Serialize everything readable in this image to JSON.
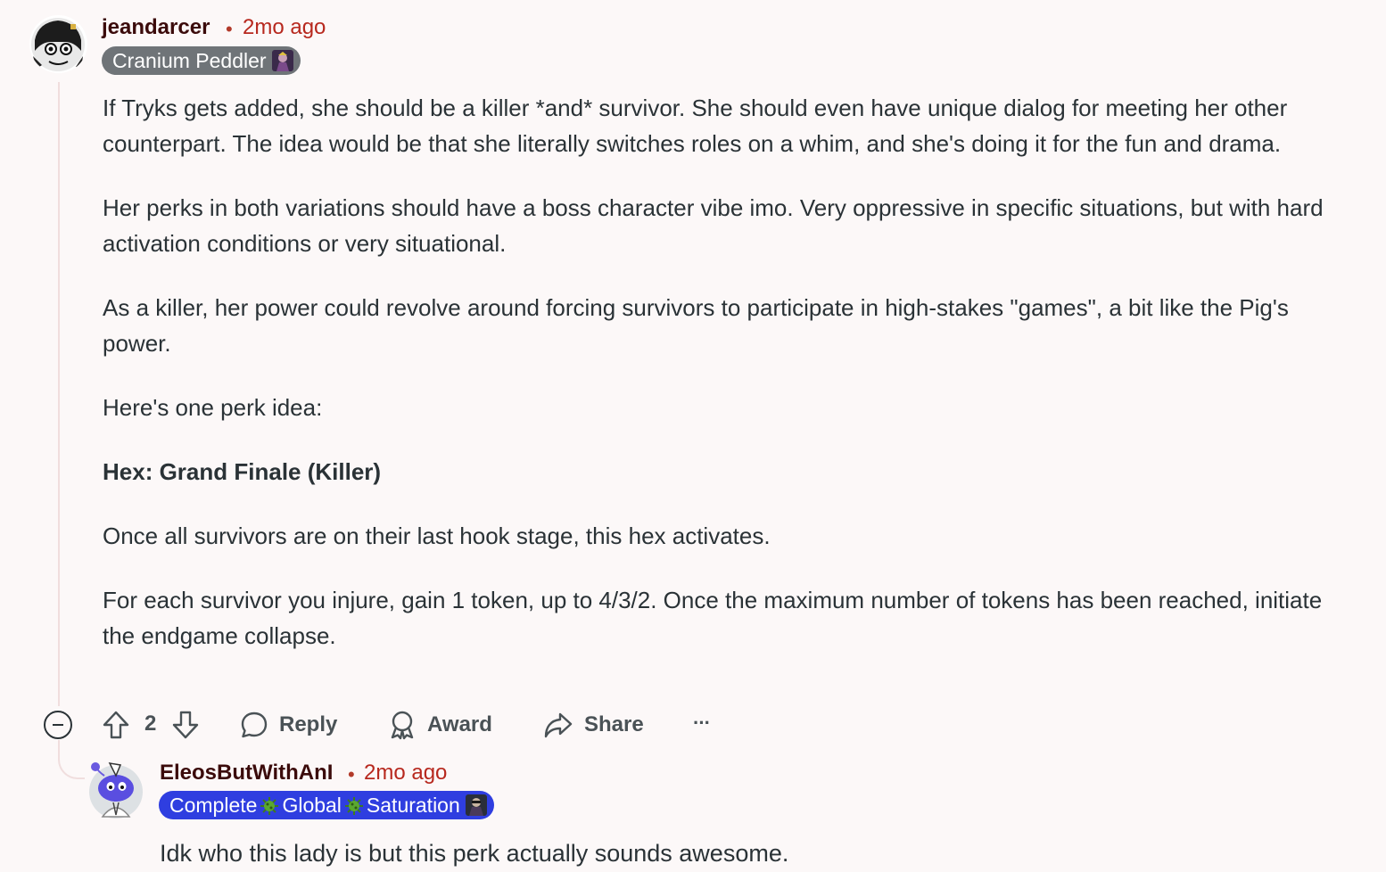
{
  "comment": {
    "author": "jeandarcer",
    "separator": "•",
    "timestamp": "2mo ago",
    "flair": "Cranium Peddler",
    "paragraphs": [
      "If Tryks gets added, she should be a killer *and* survivor. She should even have unique dialog for meeting her other counterpart. The idea would be that she literally switches roles on a whim, and she's doing it for the fun and drama.",
      "Her perks in both variations should have a boss character vibe imo. Very oppressive in specific situations, but with hard activation conditions or very situational.",
      "As a killer, her power could revolve around forcing survivors to participate in high-stakes \"games\", a bit like the Pig's power.",
      "Here's one perk idea:",
      "Hex: Grand Finale (Killer)",
      "Once all survivors are on their last hook stage, this hex activates.",
      "For each survivor you injure, gain 1 token, up to 4/3/2. Once the maximum number of tokens has been reached, initiate the endgame collapse."
    ],
    "vote_count": "2",
    "actions": {
      "reply": "Reply",
      "award": "Award",
      "share": "Share",
      "more": "···"
    }
  },
  "reply": {
    "author": "EleosButWithAnI",
    "separator": "•",
    "timestamp": "2mo ago",
    "flair_parts": [
      "Complete",
      "Global",
      "Saturation"
    ],
    "text": "Idk who this lady is but this perk actually sounds awesome."
  },
  "colors": {
    "background": "#fcf8f8",
    "username": "#3b0b0b",
    "timestamp": "#b7281e",
    "flair_gray": "#6f7478",
    "flair_blue": "#2f3ee0"
  },
  "icons": {
    "collapse": "minus-circle-icon",
    "upvote": "arrow-up-icon",
    "downvote": "arrow-down-icon",
    "reply": "speech-bubble-icon",
    "award": "award-ribbon-icon",
    "share": "share-arrow-icon",
    "more": "ellipsis-icon"
  }
}
